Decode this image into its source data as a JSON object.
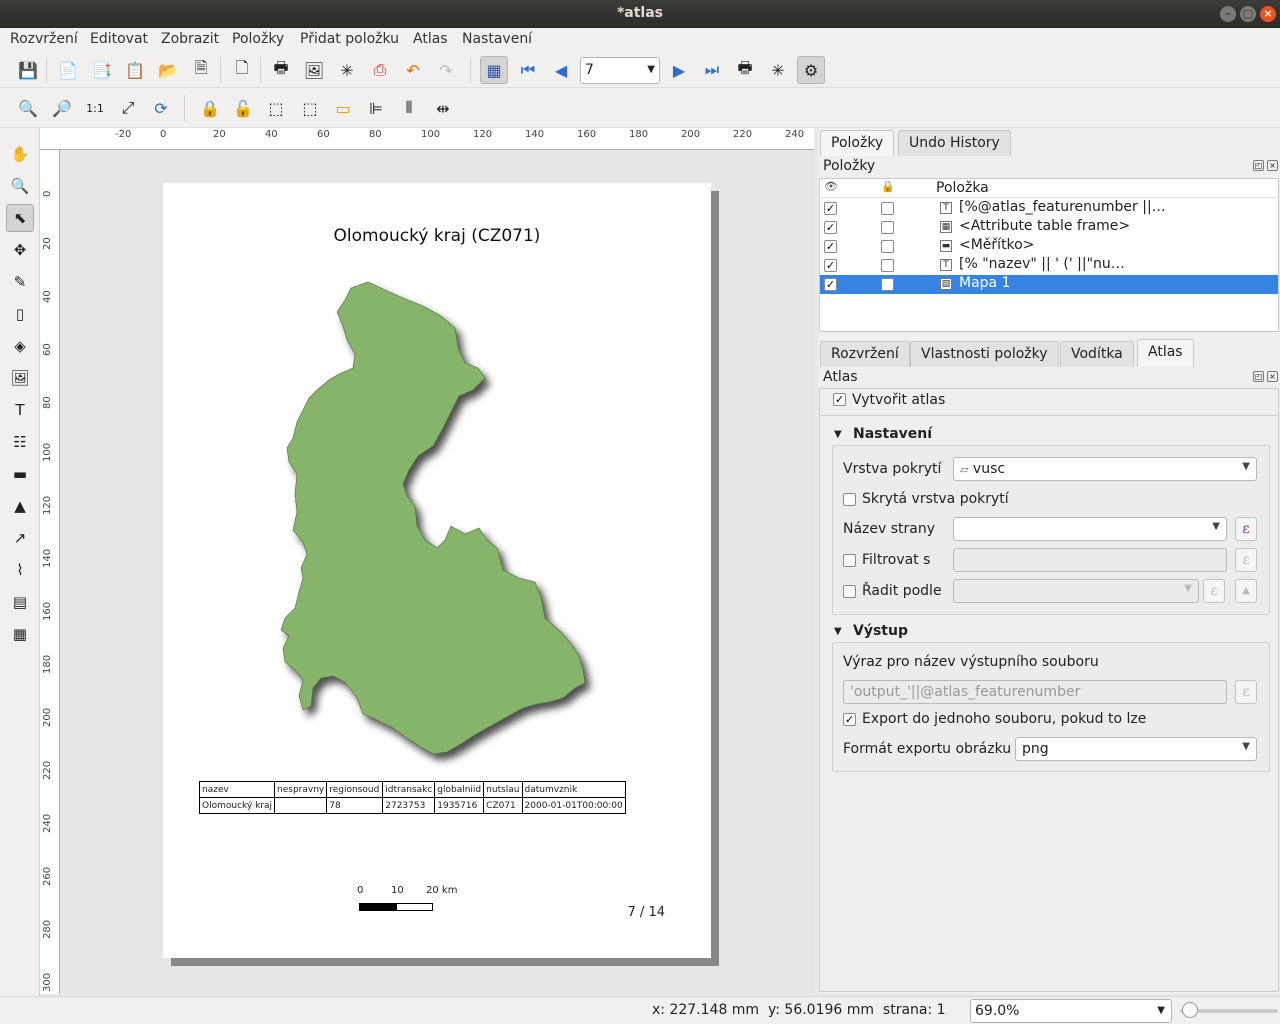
{
  "window": {
    "title": "*atlas"
  },
  "menu": [
    "Rozvržení",
    "Editovat",
    "Zobrazit",
    "Položky",
    "Přidat položku",
    "Atlas",
    "Nastavení"
  ],
  "atlas_toolbar": {
    "page_value": "7"
  },
  "ruler": {
    "h_ticks": [
      "-20",
      "0",
      "20",
      "40",
      "60",
      "80",
      "100",
      "120",
      "140",
      "160",
      "180",
      "200",
      "220",
      "240"
    ],
    "v_ticks": [
      "0",
      "20",
      "40",
      "60",
      "80",
      "100",
      "120",
      "140",
      "160",
      "180",
      "200",
      "220",
      "240",
      "260",
      "280",
      "300"
    ]
  },
  "layout": {
    "map_title": "Olomoucký kraj (CZ071)",
    "map_color": "#86b46a",
    "table": {
      "headers": [
        "nazev",
        "nespravny",
        "regionsoud",
        "idtransakc",
        "globalniid",
        "nutslau",
        "datumvznik"
      ],
      "row": [
        "Olomoucký kraj",
        "",
        "78",
        "2723753",
        "1935716",
        "CZ071",
        "2000-01-01T00:00:00"
      ]
    },
    "scalebar": {
      "labels": [
        "0",
        "10",
        "20 km"
      ]
    },
    "page_number": "7 / 14"
  },
  "items_panel": {
    "tabs": [
      "Položky",
      "Undo History"
    ],
    "title": "Položky",
    "column_header": "Položka",
    "rows": [
      {
        "label": "[%@atlas_featurenumber ||…",
        "icon": "T",
        "visible": true,
        "locked": false
      },
      {
        "label": "<Attribute table frame>",
        "icon": "▦",
        "visible": true,
        "locked": false
      },
      {
        "label": "<Měřítko>",
        "icon": "▬",
        "visible": true,
        "locked": false
      },
      {
        "label": "[% \"nazev\" || ' (' ||\"nu…",
        "icon": "T",
        "visible": true,
        "locked": false
      },
      {
        "label": "Mapa 1",
        "icon": "▧",
        "visible": true,
        "locked": false,
        "selected": true
      }
    ]
  },
  "props_panel": {
    "tabs": [
      "Rozvržení",
      "Vlastnosti položky",
      "Vodítka",
      "Atlas"
    ],
    "title": "Atlas",
    "generate_atlas": "Vytvořit atlas",
    "settings": {
      "title": "Nastavení",
      "coverage_label": "Vrstva pokrytí",
      "coverage_value": "vusc",
      "hidden_coverage": "Skrytá vrstva pokrytí",
      "page_name": "Název strany",
      "filter_with": "Filtrovat s",
      "sort_by": "Řadit podle"
    },
    "output": {
      "title": "Výstup",
      "filename_expr_label": "Výraz pro název výstupního souboru",
      "filename_expr_value": "'output_'||@atlas_featurenumber",
      "single_file": "Export do jednoho souboru, pokud to lze",
      "image_format_label": "Formát exportu obrázku",
      "image_format_value": "png"
    }
  },
  "status": {
    "coords": "x: 227.148 mm  y: 56.0196 mm  strana: 1",
    "zoom": "69.0%"
  }
}
